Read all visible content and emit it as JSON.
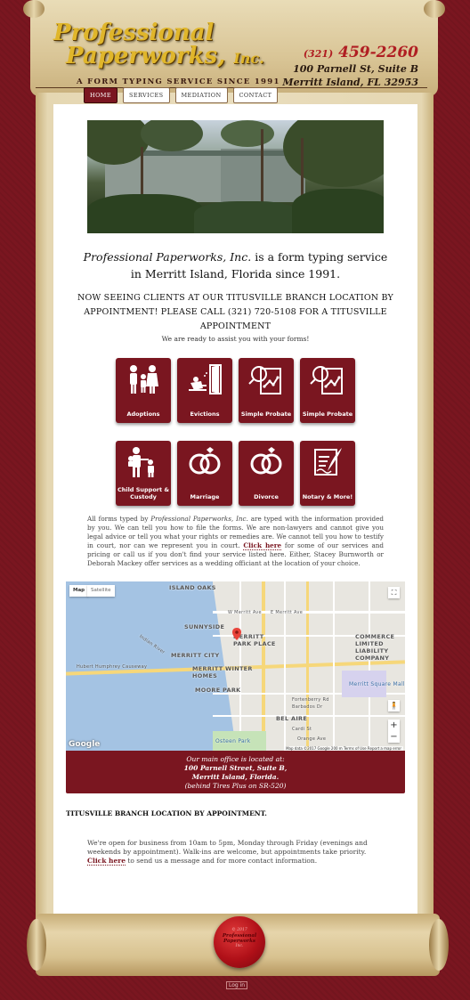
{
  "header": {
    "logo_line1": "Professional",
    "logo_line2": "Paperworks,",
    "logo_inc": "Inc.",
    "tagline": "A FORM TYPING SERVICE SINCE 1991",
    "phone_area": "(321)",
    "phone_number": "459-2260",
    "address_line1": "100 Parnell St, Suite B",
    "address_line2": "Merritt Island, FL 32953"
  },
  "nav": {
    "items": [
      {
        "label": "HOME",
        "active": true
      },
      {
        "label": "SERVICES"
      },
      {
        "label": "MEDIATION"
      },
      {
        "label": "CONTACT"
      }
    ]
  },
  "intro": {
    "brand": "Professional Paperworks, Inc.",
    "line1_rest": " is a form typing service",
    "line2": "in Merritt Island, Florida since 1991."
  },
  "notice": "NOW SEEING CLIENTS AT OUR TITUSVILLE BRANCH LOCATION BY APPOINTMENT! PLEASE CALL (321) 720-5108 FOR A TITUSVILLE APPOINTMENT",
  "ready_text": "We are ready to assist you with your forms!",
  "services": [
    {
      "label": "Adoptions",
      "icon": "family-icon"
    },
    {
      "label": "Evictions",
      "icon": "eviction-icon"
    },
    {
      "label": "Simple Probate",
      "icon": "probate-icon"
    },
    {
      "label": "Simple Probate",
      "icon": "probate-icon"
    },
    {
      "label": "Child Support & Custody",
      "icon": "child-support-icon"
    },
    {
      "label": "Marriage",
      "icon": "rings-icon"
    },
    {
      "label": "Divorce",
      "icon": "rings-icon"
    },
    {
      "label": "Notary & More!",
      "icon": "notary-icon"
    }
  ],
  "disclaimer": {
    "p1": "All forms typed by ",
    "brand": "Professional Paperworks, Inc.",
    "p2": " are typed with the information provided by you. We can tell you how to file the forms. We are non-lawyers and cannot give you legal advice or tell you what your rights or remedies are. We cannot tell you how to testify in court, nor can we represent you in court. ",
    "link": "Click here",
    "p3": " for some of our services and pricing or call us if you don't find your service listed here. Either, Stacey Burnworth or Deborah Mackey offer services as a wedding officiant at the location of your choice."
  },
  "map": {
    "btn_map": "Map",
    "btn_satellite": "Satellite",
    "labels": {
      "island_oaks": "ISLAND OAKS",
      "sunnyside": "SUNNYSIDE",
      "merritt_park": "MERRITT PARK PLACE",
      "merritt_city": "MERRITT CITY",
      "merritt_winter": "MERRITT WINTER HOMES",
      "moore_park": "MOORE PARK",
      "bel_aire": "BEL AIRE",
      "commerce": "COMMERCE LIMITED LIABILITY COMPANY",
      "causeway": "Hubert Humphrey Causeway",
      "indian_river": "Indian River",
      "square_mall": "Merritt Square Mall",
      "osteen": "Osteen Park",
      "merritt_ave": "W Merritt Ave",
      "e_merritt": "E Merritt Ave",
      "fortenberry": "Fortenberry Rd",
      "barbados": "Barbados Dr",
      "orange": "Orange Ave",
      "cardi": "Cardi St"
    },
    "google": "Google",
    "footer": "Map data ©2017 Google   200 m   Terms of Use   Report a map error",
    "zoom_in": "+",
    "zoom_out": "−"
  },
  "office": {
    "line1": "Our main office is located at:",
    "line2": "100 Parnell Street, Suite B,",
    "line3": "Merritt Island, Florida.",
    "line4": "(behind Tires Plus on SR-520)"
  },
  "titusville": "TITUSVILLE BRANCH LOCATION BY APPOINTMENT.",
  "hours": {
    "text": "We're open for business from 10am to 5pm, Monday through Friday (evenings and weekends by appointment). Walk-ins are welcome, but appointments take priority. ",
    "link": "Click here",
    "rest": " to send us a message and for more contact information."
  },
  "seal": {
    "copyright": "© 2017",
    "name": "Professional Paperworks",
    "inc": "Inc."
  },
  "login": "Log in",
  "colors": {
    "accent": "#7a1620",
    "gold": "#e0b62b",
    "phone": "#b01e22"
  }
}
